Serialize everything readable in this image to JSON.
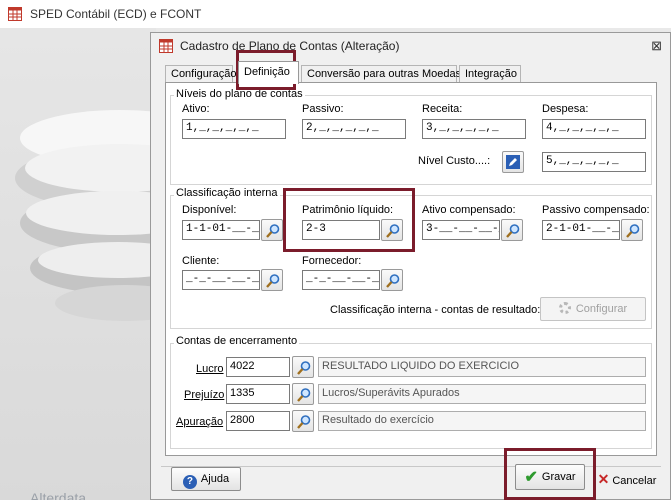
{
  "app": {
    "title": "SPED Contábil (ECD) e FCONT",
    "logo_text": "Alterdata"
  },
  "dialog": {
    "title": "Cadastro de Plano de Contas (Alteração)",
    "close_glyph": "⊠"
  },
  "tabs": [
    {
      "label": "Configuração",
      "active": false
    },
    {
      "label": "Definição",
      "active": true
    },
    {
      "label": "Conversão para outras Moedas",
      "active": false
    },
    {
      "label": "Integração",
      "active": false
    }
  ],
  "niveis": {
    "legend": "Níveis do plano de contas",
    "ativo_label": "Ativo:",
    "ativo_value": "1,_,_,_,_,_",
    "passivo_label": "Passivo:",
    "passivo_value": "2,_,_,_,_,_",
    "receita_label": "Receita:",
    "receita_value": "3,_,_,_,_,_",
    "despesa_label": "Despesa:",
    "despesa_value": "4,_,_,_,_,_",
    "custo_label": "Nível Custo....:",
    "custo_value": "5,_,_,_,_,_"
  },
  "classificacao": {
    "legend": "Classificação interna",
    "disponivel_label": "Disponível:",
    "disponivel_value": "1-1-01-__-__",
    "patrimonio_label": "Patrimônio líquido:",
    "patrimonio_value": "2-3",
    "ativo_comp_label": "Ativo compensado:",
    "ativo_comp_value": "3-__-__-__-__",
    "passivo_comp_label": "Passivo compensado:",
    "passivo_comp_value": "2-1-01-__-__",
    "cliente_label": "Cliente:",
    "cliente_value": "_-_-__-__-__",
    "fornecedor_label": "Fornecedor:",
    "fornecedor_value": "_-_-__-__-__",
    "resultado_label": "Classificação interna - contas de resultado:",
    "configurar_label": "Configurar"
  },
  "encerramento": {
    "legend": "Contas de encerramento",
    "lucro_label": "Lucro",
    "lucro_code": "4022",
    "lucro_desc": "RESULTADO LIQUIDO DO EXERCICIO",
    "prejuizo_label": "Prejuízo",
    "prejuizo_code": "1335",
    "prejuizo_desc": "Lucros/Superávits Apurados",
    "apuracao_label": "Apuração",
    "apuracao_code": "2800",
    "apuracao_desc": "Resultado do exercício"
  },
  "footer": {
    "ajuda_label": "Ajuda",
    "gravar_label": "Gravar",
    "cancelar_label": "Cancelar"
  },
  "colors": {
    "highlight": "#7b1c2b",
    "help_icon": "#2b5fb5",
    "save_check": "#2e9a2e",
    "cancel_x": "#c62828"
  }
}
